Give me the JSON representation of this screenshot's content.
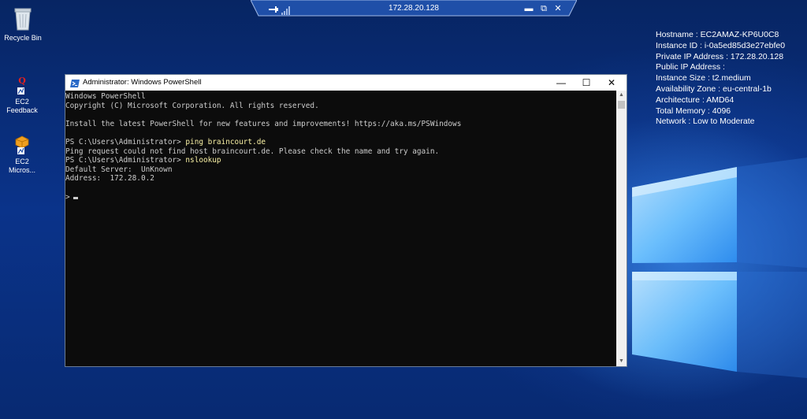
{
  "rdp_bar": {
    "title": "172.28.20.128",
    "minimize_label": "▬",
    "restore_label": "⧉",
    "close_label": "✕"
  },
  "desktop_icons": [
    {
      "label_lines": [
        "Recycle Bin"
      ],
      "icon": "recycle-bin-icon"
    },
    {
      "label_lines": [
        "EC2",
        "Feedback"
      ],
      "icon": "ec2-feedback-icon"
    },
    {
      "label_lines": [
        "EC2",
        "Micros..."
      ],
      "icon": "ec2-microsoft-icon"
    }
  ],
  "system_info": [
    "Hostname : EC2AMAZ-KP6U0C8",
    "Instance ID : i-0a5ed85d3e27ebfe0",
    "Private IP Address : 172.28.20.128",
    "Public IP Address :",
    "Instance Size : t2.medium",
    "Availability Zone : eu-central-1b",
    "Architecture : AMD64",
    "Total Memory : 4096",
    "Network : Low to Moderate"
  ],
  "powershell": {
    "title": "Administrator: Windows PowerShell",
    "minimize_label": "—",
    "maximize_label": "☐",
    "close_label": "✕",
    "lines": {
      "l1": "Windows PowerShell",
      "l2": "Copyright (C) Microsoft Corporation. All rights reserved.",
      "l3": "",
      "l4": "Install the latest PowerShell for new features and improvements! https://aka.ms/PSWindows",
      "l5": "",
      "l6_prompt": "PS C:\\Users\\Administrator> ",
      "l6_cmd": "ping braincourt.de",
      "l7": "Ping request could not find host braincourt.de. Please check the name and try again.",
      "l8_prompt": "PS C:\\Users\\Administrator> ",
      "l8_cmd": "nslookup",
      "l9": "Default Server:  UnKnown",
      "l10": "Address:  172.28.0.2",
      "l11": "",
      "l12_prompt": ">"
    }
  },
  "colors": {
    "console_bg": "#0c0c0c",
    "console_text": "#cccccc",
    "command_text": "#f9f1a5",
    "desktop_bg": "#0a338a"
  }
}
